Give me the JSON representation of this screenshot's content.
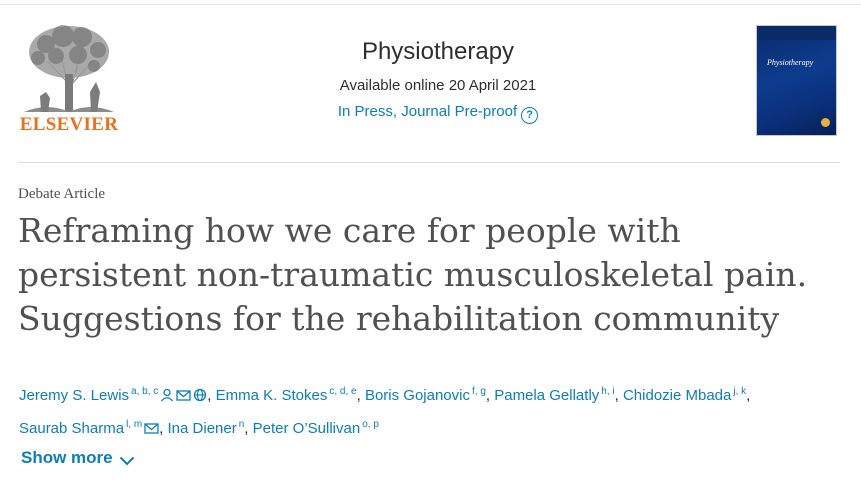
{
  "publisher": {
    "name": "ELSEVIER"
  },
  "journal": {
    "title": "Physiotherapy",
    "available": "Available online 20 April 2021",
    "status_link": "In Press, Journal Pre-proof",
    "cover_title": "Physiotherapy"
  },
  "article": {
    "type": "Debate Article",
    "title": "Reframing how we care for people with persistent non-traumatic musculoskeletal pain. Suggestions for the rehabilitation community"
  },
  "authors": [
    {
      "name": "Jeremy S. Lewis",
      "aff": "a, b, c",
      "icons": [
        "person-icon",
        "email-icon",
        "globe-icon"
      ]
    },
    {
      "name": "Emma K. Stokes",
      "aff": "c, d, e",
      "icons": []
    },
    {
      "name": "Boris Gojanovic",
      "aff": "f, g",
      "icons": []
    },
    {
      "name": "Pamela Gellatly",
      "aff": "h, i",
      "icons": []
    },
    {
      "name": "Chidozie Mbada",
      "aff": "j, k",
      "icons": []
    },
    {
      "name": "Saurab Sharma",
      "aff": "l, m",
      "icons": [
        "email-icon"
      ]
    },
    {
      "name": "Ina Diener",
      "aff": "n",
      "icons": []
    },
    {
      "name": "Peter O’Sullivan",
      "aff": "o, p",
      "icons": []
    }
  ],
  "show_more": {
    "label": "Show more"
  },
  "colors": {
    "link": "#0c7dbb",
    "publisher_orange": "#e9711c",
    "text": "#2e2e2e"
  }
}
